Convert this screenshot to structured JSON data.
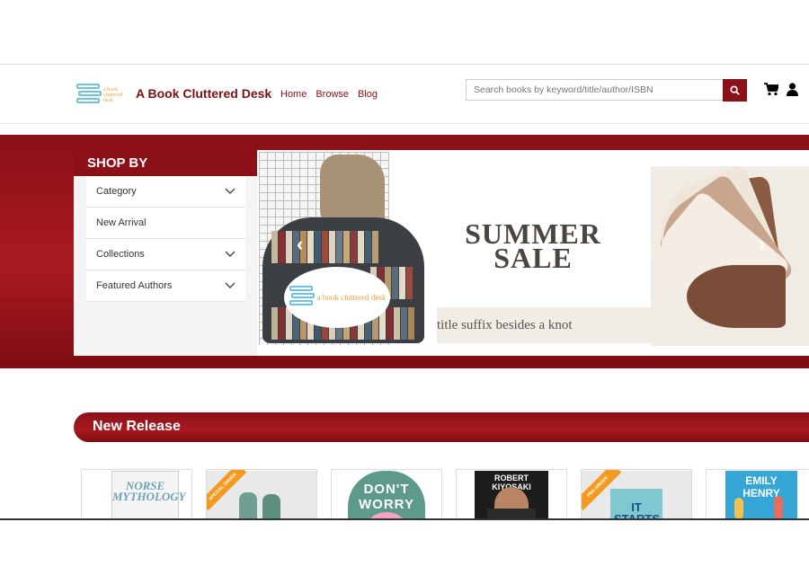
{
  "header": {
    "logo_text": "a book cluttered desk",
    "brand": "A Book Cluttered Desk",
    "nav": [
      "Home",
      "Browse",
      "Blog"
    ],
    "search_placeholder": "Search books by keyword/title/author/ISBN",
    "icons": {
      "search": "search-icon",
      "cart": "cart-icon",
      "user": "user-icon"
    }
  },
  "shop_by": {
    "title": "SHOP BY",
    "items": [
      {
        "label": "Category",
        "expandable": true
      },
      {
        "label": "New Arrival",
        "expandable": false
      },
      {
        "label": "Collections",
        "expandable": true
      },
      {
        "label": "Featured Authors",
        "expandable": true
      }
    ]
  },
  "banner": {
    "line1": "SUMMER",
    "line2": "SALE",
    "logo_text": "a book cluttered desk",
    "newsprint": "title   suffix   besides   a knot"
  },
  "new_release": {
    "title": "New Release",
    "books": [
      {
        "cover_text": "NORSE MYTHOLOGY",
        "ribbon": "",
        "color": "#f5f5f5"
      },
      {
        "cover_text": "",
        "ribbon": "SPECIAL ORDER",
        "color": "#e8e8e8"
      },
      {
        "cover_text": "DON'T WORRY",
        "ribbon": "",
        "color": "#5e9a8c"
      },
      {
        "cover_text": "ROBERT KIYOSAKI",
        "ribbon": "",
        "color": "#1c1c1c"
      },
      {
        "cover_text": "IT STARTS",
        "ribbon": "PRE-ORDER",
        "color": "#e8e8e8"
      },
      {
        "cover_text": "EMILY HENRY",
        "ribbon": "",
        "color": "#35a6d6"
      }
    ]
  },
  "colors": {
    "accent": "#8b1017",
    "logo_blue": "#6fc3df",
    "logo_orange": "#e7a33b"
  }
}
